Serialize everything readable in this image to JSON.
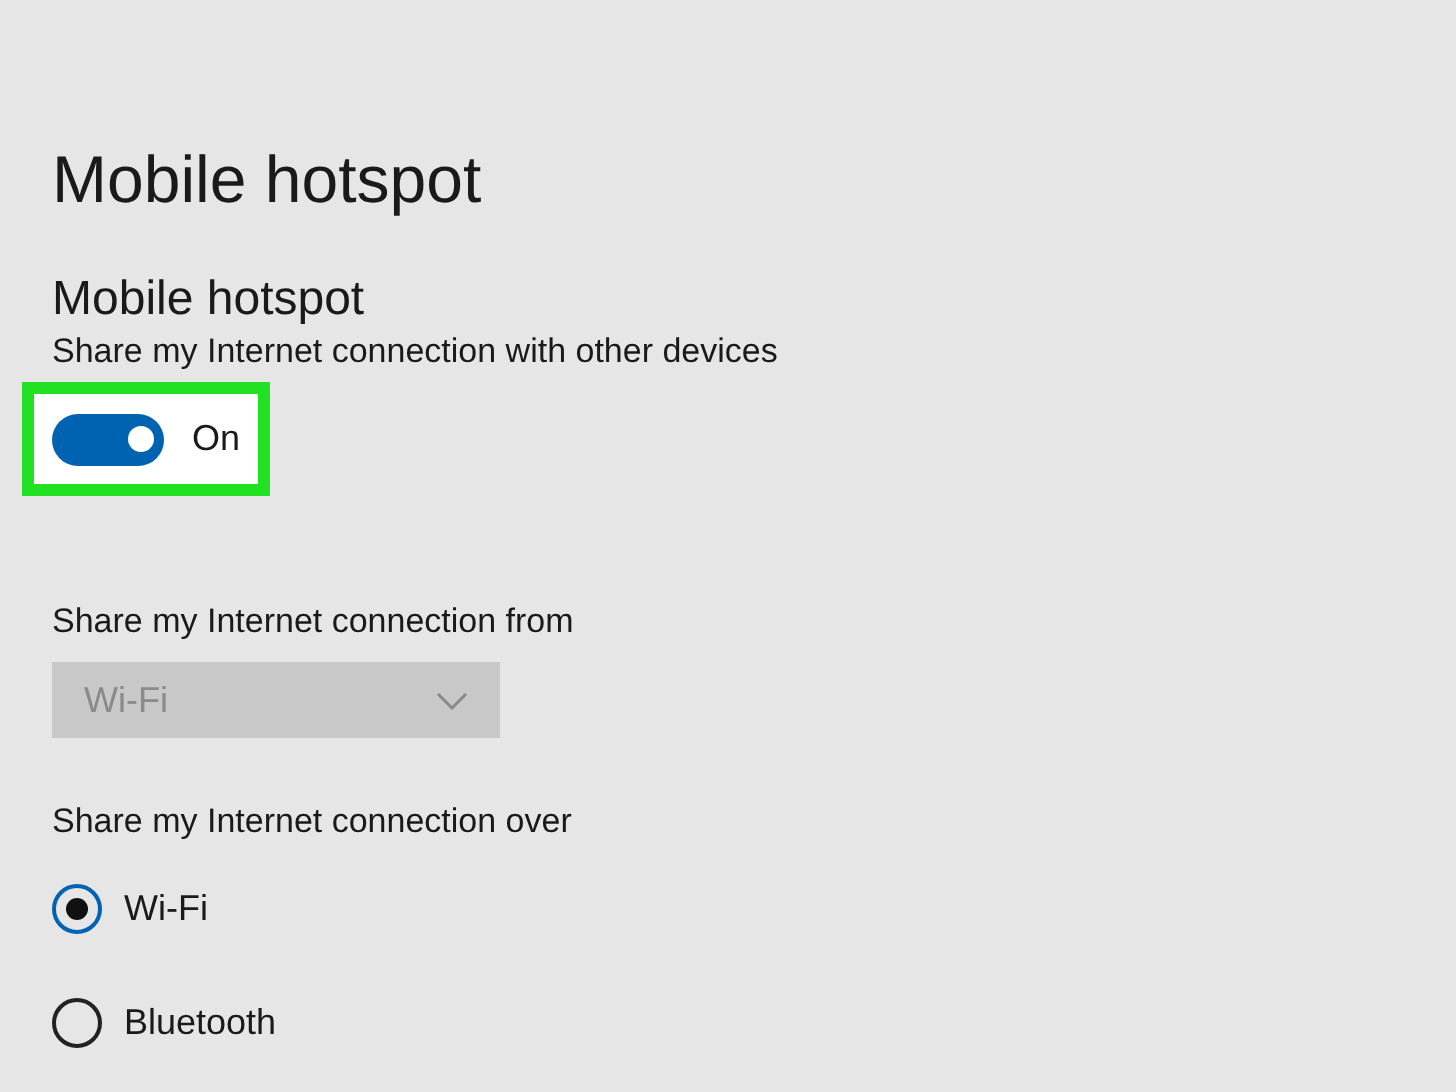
{
  "page_title": "Mobile hotspot",
  "section": {
    "heading": "Mobile hotspot",
    "description": "Share my Internet connection with other devices",
    "toggle": {
      "on": true,
      "label": "On",
      "highlighted": true
    }
  },
  "source": {
    "label": "Share my Internet connection from",
    "dropdown": {
      "value": "Wi-Fi",
      "disabled": true
    }
  },
  "share_over": {
    "label": "Share my Internet connection over",
    "options": [
      {
        "label": "Wi-Fi",
        "selected": true
      },
      {
        "label": "Bluetooth",
        "selected": false
      }
    ]
  }
}
